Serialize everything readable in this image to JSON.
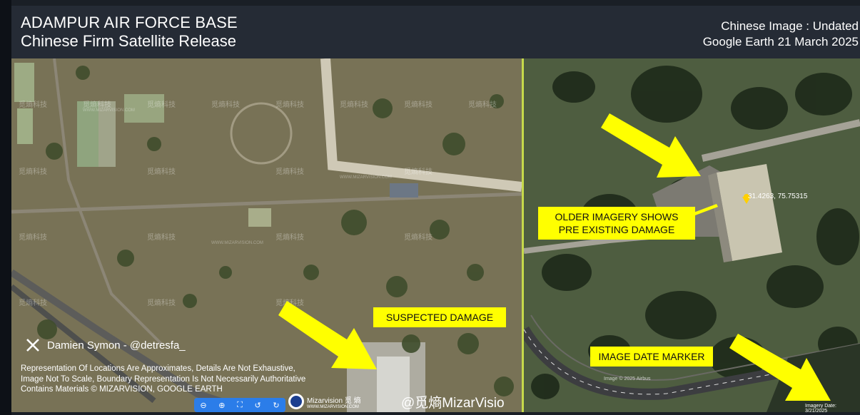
{
  "header": {
    "title": "ADAMPUR AIR FORCE BASE",
    "subtitle": "Chinese Firm Satellite Release",
    "right_line1": "Chinese Image : Undated",
    "right_line2": "Google Earth 21 March 2025"
  },
  "left_panel": {
    "damage_label": "SUSPECTED DAMAGE",
    "watermark_cn": "觅熵科技",
    "watermark_url": "WWW.MIZARVISION.COM",
    "credit": "Damien Symon - @detresfa_",
    "disclaimer_1": "Representation Of Locations Are Approximates, Details Are Not Exhaustive,",
    "disclaimer_2": "Image Not To Scale, Boundary Representation Is Not Necessarily Authoritative",
    "disclaimer_3": "Contains Materials © MIZARVISION, GOOGLE EARTH",
    "toolbar_icons": [
      "zoom-out-icon",
      "zoom-in-icon",
      "fullscreen-icon",
      "rotate-left-icon",
      "rotate-right-icon"
    ],
    "mizar_logo_text": "Mizarvision 觅 熵",
    "mizar_logo_url": "WWW.MIZARVISION.COM",
    "mizar_handle": "@觅熵MizarVisio"
  },
  "right_panel": {
    "older_label_1": "OLDER IMAGERY SHOWS",
    "older_label_2": "PRE EXISTING DAMAGE",
    "coordinates": "31.4263, 75.75315",
    "date_marker_label": "IMAGE DATE MARKER",
    "image_credit": "Image © 2025 Airbus",
    "imagery_date": "Imagery Date: 3/21/2025"
  },
  "colors": {
    "highlight": "#ffff00",
    "header_bg": "#252b35",
    "divider": "#c6d94b"
  }
}
